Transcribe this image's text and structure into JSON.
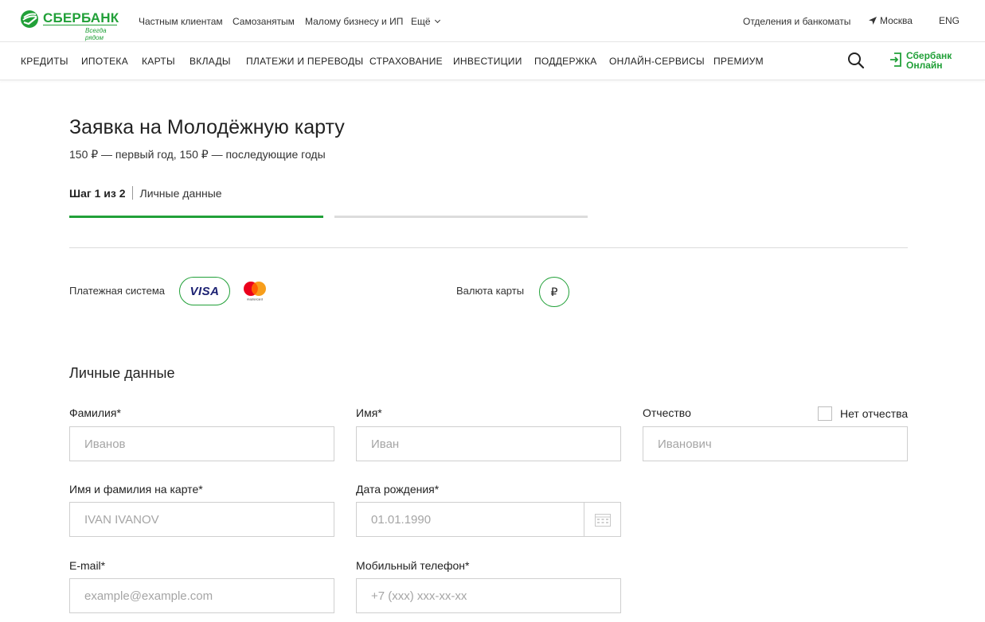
{
  "brand": {
    "name": "СБЕРБАНК",
    "slogan": "Всегда рядом",
    "color": "#21a038"
  },
  "topnav": {
    "items": [
      "Частным клиентам",
      "Самозанятым",
      "Малому бизнесу и ИП",
      "Ещё"
    ],
    "branches": "Отделения и банкоматы",
    "city": "Москва",
    "lang": "ENG"
  },
  "mainnav": {
    "items": [
      "КРЕДИТЫ",
      "ИПОТЕКА",
      "КАРТЫ",
      "ВКЛАДЫ",
      "ПЛАТЕЖИ И ПЕРЕВОДЫ",
      "СТРАХОВАНИЕ",
      "ИНВЕСТИЦИИ",
      "ПОДДЕРЖКА",
      "ОНЛАЙН-СЕРВИСЫ",
      "ПРЕМИУМ"
    ],
    "search_icon": "search-icon",
    "online_line1": "Сбербанк",
    "online_line2": "Онлайн"
  },
  "page": {
    "title": "Заявка на Молодёжную карту",
    "subtitle": "150 ₽ — первый год, 150 ₽ — последующие годы",
    "step_num": "Шаг 1 из 2",
    "step_name": "Личные данные",
    "progress_fraction": 0.5
  },
  "card_options": {
    "payment_system_label": "Платежная система",
    "visa_label": "VISA",
    "mastercard_label": "mastercard",
    "currency_label": "Валюта карты",
    "currency_symbol": "₽"
  },
  "form": {
    "section_title": "Личные данные",
    "surname": {
      "label": "Фамилия*",
      "placeholder": "Иванов"
    },
    "name": {
      "label": "Имя*",
      "placeholder": "Иван"
    },
    "patronymic": {
      "label": "Отчество",
      "placeholder": "Иванович"
    },
    "no_patronymic": "Нет отчества",
    "card_name": {
      "label": "Имя и фамилия на карте*",
      "placeholder": "IVAN IVANOV"
    },
    "birthdate": {
      "label": "Дата рождения*",
      "placeholder": "01.01.1990"
    },
    "email": {
      "label": "E-mail*",
      "placeholder": "example@example.com"
    },
    "phone": {
      "label": "Мобильный телефон*",
      "placeholder": "+7 (xxx) xxx-xx-xx"
    }
  }
}
